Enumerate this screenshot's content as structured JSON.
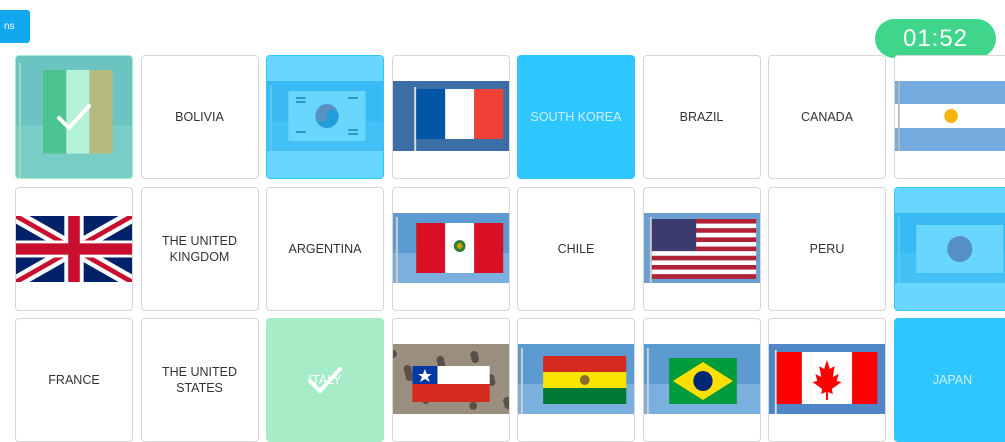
{
  "header": {
    "options_label": "ns",
    "timer": "01:52"
  },
  "cards": [
    {
      "type": "flag",
      "flag": "ireland-flag-icon",
      "state": "matched",
      "row": 0,
      "col": 0
    },
    {
      "type": "text",
      "label": "BOLIVIA",
      "state": "normal",
      "row": 0,
      "col": 1
    },
    {
      "type": "flag",
      "flag": "south-korea-flag-icon",
      "state": "selected",
      "row": 0,
      "col": 2
    },
    {
      "type": "flag",
      "flag": "france-flag-icon",
      "state": "normal",
      "row": 0,
      "col": 3
    },
    {
      "type": "text",
      "label": "SOUTH KOREA",
      "state": "selected",
      "row": 0,
      "col": 4
    },
    {
      "type": "text",
      "label": "BRAZIL",
      "state": "normal",
      "row": 0,
      "col": 5
    },
    {
      "type": "text",
      "label": "CANADA",
      "state": "normal",
      "row": 0,
      "col": 6
    },
    {
      "type": "flag",
      "flag": "argentina-flag-icon",
      "state": "normal",
      "row": 0,
      "col": 7
    },
    {
      "type": "flag",
      "flag": "united-kingdom-flag-icon",
      "state": "normal",
      "row": 1,
      "col": 0
    },
    {
      "type": "text",
      "label": "THE UNITED KINGDOM",
      "state": "normal",
      "row": 1,
      "col": 1
    },
    {
      "type": "text",
      "label": "ARGENTINA",
      "state": "normal",
      "row": 1,
      "col": 2
    },
    {
      "type": "flag",
      "flag": "peru-flag-icon",
      "state": "normal",
      "row": 1,
      "col": 3
    },
    {
      "type": "text",
      "label": "CHILE",
      "state": "normal",
      "row": 1,
      "col": 4
    },
    {
      "type": "flag",
      "flag": "usa-flag-icon",
      "state": "normal",
      "row": 1,
      "col": 5
    },
    {
      "type": "text",
      "label": "PERU",
      "state": "normal",
      "row": 1,
      "col": 6
    },
    {
      "type": "flag",
      "flag": "japan-flag-icon",
      "state": "selected",
      "row": 1,
      "col": 7
    },
    {
      "type": "text",
      "label": "FRANCE",
      "state": "normal",
      "row": 2,
      "col": 0
    },
    {
      "type": "text",
      "label": "THE UNITED STATES",
      "state": "normal",
      "row": 2,
      "col": 1
    },
    {
      "type": "text",
      "label": "ITALY",
      "state": "matched",
      "row": 2,
      "col": 2
    },
    {
      "type": "flag",
      "flag": "chile-flag-icon",
      "state": "normal",
      "row": 2,
      "col": 3
    },
    {
      "type": "flag",
      "flag": "bolivia-flag-icon",
      "state": "normal",
      "row": 2,
      "col": 4
    },
    {
      "type": "flag",
      "flag": "brazil-flag-icon",
      "state": "normal",
      "row": 2,
      "col": 5
    },
    {
      "type": "flag",
      "flag": "canada-flag-icon",
      "state": "normal",
      "row": 2,
      "col": 6
    },
    {
      "type": "text",
      "label": "JAPAN",
      "state": "selected",
      "row": 2,
      "col": 7
    }
  ],
  "colors": {
    "selected": "#2ec6ff",
    "matched": "#a6ecc7",
    "timer": "#3fd68c",
    "button": "#12a8f0"
  }
}
